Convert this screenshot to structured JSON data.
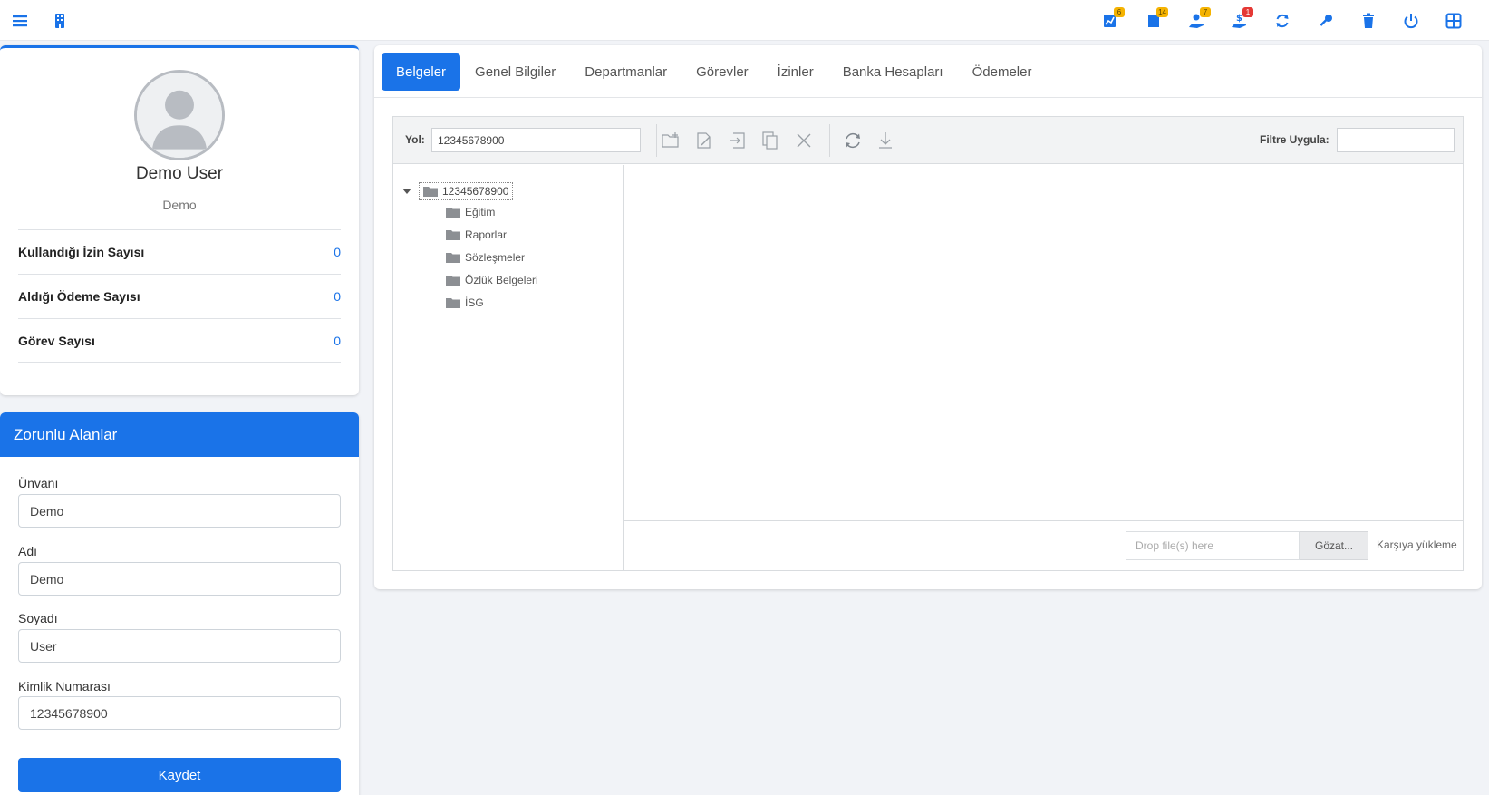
{
  "topbar": {
    "badges": {
      "tasks": "6",
      "documents": "14",
      "leaves": "7",
      "payments": "1"
    }
  },
  "profile": {
    "name": "Demo User",
    "role": "Demo",
    "stats": [
      {
        "label": "Kullandığı İzin Sayısı",
        "value": "0"
      },
      {
        "label": "Aldığı Ödeme Sayısı",
        "value": "0"
      },
      {
        "label": "Görev Sayısı",
        "value": "0"
      }
    ]
  },
  "required": {
    "title": "Zorunlu Alanlar",
    "fields": [
      {
        "label": "Ünvanı",
        "value": "Demo"
      },
      {
        "label": "Adı",
        "value": "Demo"
      },
      {
        "label": "Soyadı",
        "value": "User"
      },
      {
        "label": "Kimlik Numarası",
        "value": "12345678900"
      }
    ],
    "save_label": "Kaydet"
  },
  "tabs": [
    {
      "label": "Belgeler",
      "active": true
    },
    {
      "label": "Genel Bilgiler"
    },
    {
      "label": "Departmanlar"
    },
    {
      "label": "Görevler"
    },
    {
      "label": "İzinler"
    },
    {
      "label": "Banka Hesapları"
    },
    {
      "label": "Ödemeler"
    }
  ],
  "filemanager": {
    "path_label": "Yol:",
    "path_value": "12345678900",
    "filter_label": "Filtre Uygula:",
    "filter_value": "",
    "tree": {
      "root": "12345678900",
      "children": [
        "Eğitim",
        "Raporlar",
        "Sözleşmeler",
        "Özlük Belgeleri",
        "İSG"
      ]
    },
    "upload": {
      "drop_placeholder": "Drop file(s) here",
      "browse_label": "Gözat...",
      "upload_label": "Karşıya yükleme"
    }
  }
}
